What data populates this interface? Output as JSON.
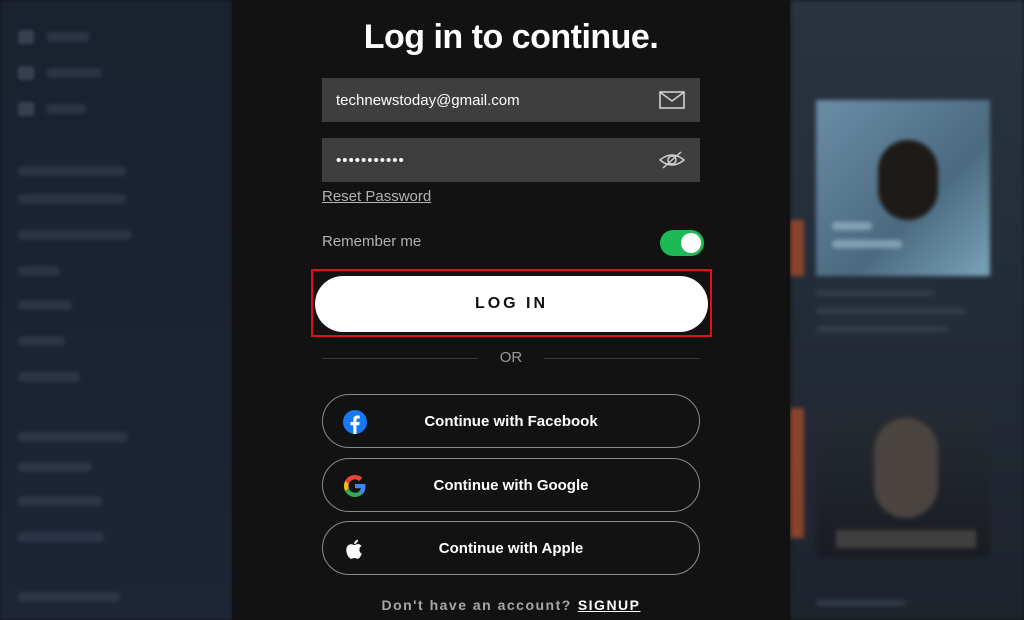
{
  "modal": {
    "title": "Log in to continue.",
    "email": {
      "value": "technewstoday@gmail.com",
      "icon": "mail-icon"
    },
    "password": {
      "value": "•••••••••••",
      "icon": "eye-off-icon"
    },
    "reset_password": "Reset Password",
    "remember_me": {
      "label": "Remember me",
      "enabled": true
    },
    "login_label": "LOG IN",
    "divider_label": "OR",
    "social": [
      {
        "label": "Continue with Facebook",
        "icon": "facebook-icon"
      },
      {
        "label": "Continue with Google",
        "icon": "google-icon"
      },
      {
        "label": "Continue with Apple",
        "icon": "apple-icon"
      }
    ],
    "footer": {
      "prompt": "Don't have an account?",
      "signup": "SIGNUP"
    }
  },
  "colors": {
    "accent": "#1db954",
    "highlight": "#e0101a",
    "modal_bg": "#121212",
    "field_bg": "#3e3e3e"
  }
}
